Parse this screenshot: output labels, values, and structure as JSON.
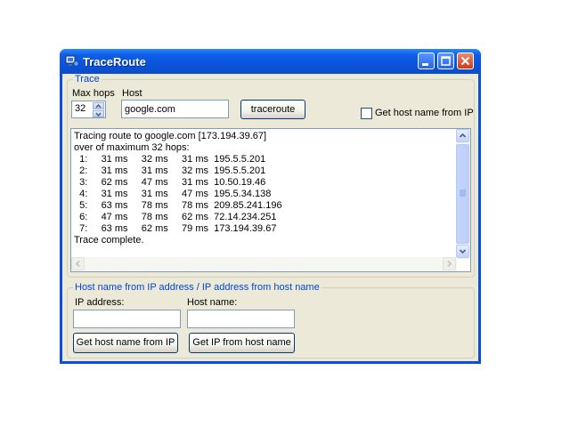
{
  "window": {
    "title": "TraceRoute",
    "icon": "traceroute-app-icon"
  },
  "trace_group": {
    "legend": "Trace",
    "max_hops_label": "Max hops",
    "max_hops_value": "32",
    "host_label": "Host",
    "host_value": "google.com",
    "traceroute_button": "traceroute",
    "get_host_name_checkbox": "Get host name from IP",
    "get_host_name_checked": false
  },
  "output": {
    "lines": [
      "Tracing route to google.com [173.194.39.67]",
      "over of maximum 32 hops:",
      "  1:     31 ms     32 ms     31 ms  195.5.5.201",
      "  2:     31 ms     31 ms     32 ms  195.5.5.201",
      "  3:     62 ms     47 ms     31 ms  10.50.19.46",
      "  4:     31 ms     31 ms     47 ms  195.5.34.138",
      "  5:     63 ms     78 ms     78 ms  209.85.241.196",
      "  6:     47 ms     78 ms     62 ms  72.14.234.251",
      "  7:     63 ms     62 ms     79 ms  173.194.39.67",
      "Trace complete."
    ]
  },
  "lookup_group": {
    "legend": "Host name from IP address / IP address from host name",
    "ip_label": "IP address:",
    "ip_value": "",
    "host_label": "Host name:",
    "host_value": "",
    "get_host_button": "Get host name from IP",
    "get_ip_button": "Get IP from host name"
  },
  "colors": {
    "titlebar": "#0a54dc",
    "legend_text": "#0046d5",
    "client_bg": "#ece9d8"
  }
}
